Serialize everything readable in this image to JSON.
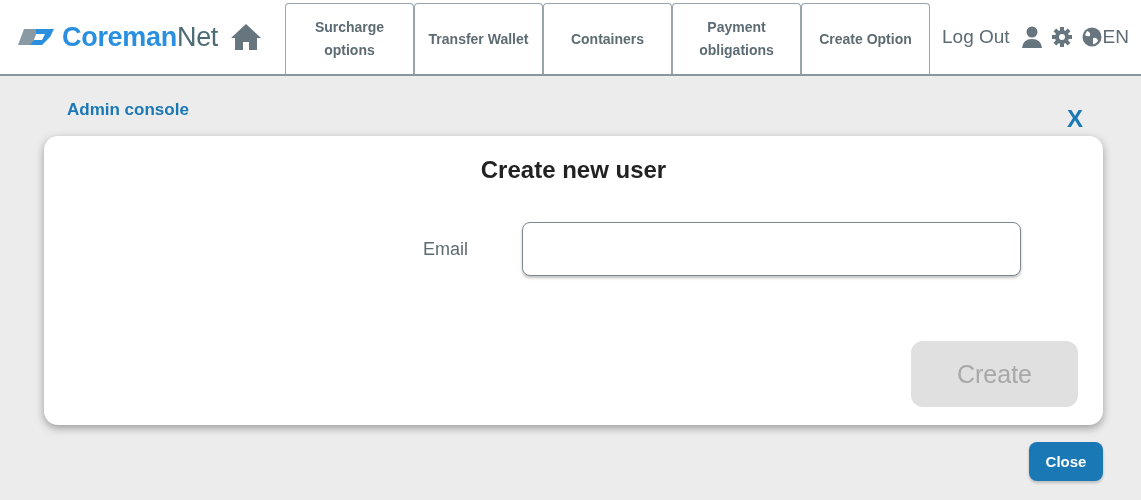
{
  "header": {
    "logo": {
      "brand": "Coreman",
      "suffix": "Net"
    },
    "tabs": [
      {
        "label": "Surcharge options"
      },
      {
        "label": "Transfer Wallet"
      },
      {
        "label": "Containers"
      },
      {
        "label": "Payment obligations"
      },
      {
        "label": "Create Option"
      }
    ],
    "logout": "Log Out",
    "language": "EN"
  },
  "breadcrumb": "Admin console",
  "close_x": "X",
  "dialog": {
    "title": "Create new user",
    "fields": [
      {
        "label": "Email"
      }
    ],
    "submit": {
      "label": "Create",
      "disabled": true
    }
  },
  "close_button": "Close"
}
